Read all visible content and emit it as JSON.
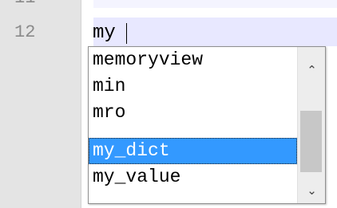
{
  "editor": {
    "line_number": "12",
    "partial_line_number_above": "11",
    "typed_text": "my"
  },
  "autocomplete": {
    "items": [
      {
        "label": "memoryview"
      },
      {
        "label": "min"
      },
      {
        "label": "mro"
      },
      {
        "label": "my_dict"
      },
      {
        "label": "my_value"
      }
    ],
    "selected_label": "my_dict",
    "scroll_up_icon": "chevron-up-icon",
    "scroll_down_icon": "chevron-down-icon"
  },
  "colors": {
    "gutter": "#e4e4e4",
    "current_line": "#e8e8ff",
    "selection": "#3399ff"
  }
}
